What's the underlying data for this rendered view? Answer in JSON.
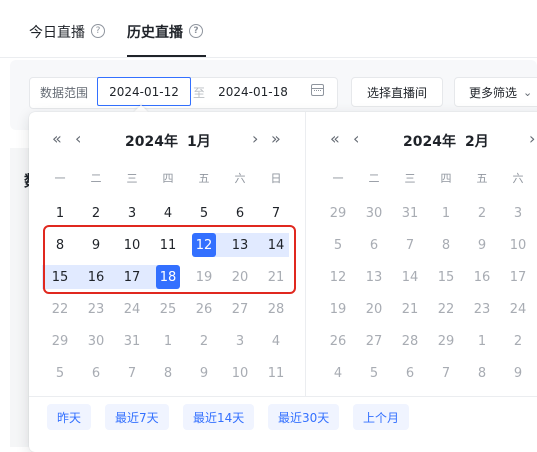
{
  "tabs": [
    {
      "label": "今日直播",
      "help": "?"
    },
    {
      "label": "历史直播",
      "help": "?"
    }
  ],
  "filter": {
    "range_label": "数据范围",
    "start_date": "2024-01-12",
    "separator": "至",
    "end_date": "2024-01-18",
    "select_room_label": "选择直播间",
    "more_filter_label": "更多筛选"
  },
  "calendar": {
    "nav": {
      "prev_year": "«",
      "prev_month": "‹",
      "next_month": "›",
      "next_year": "»"
    },
    "weekdays": [
      "一",
      "二",
      "三",
      "四",
      "五",
      "六",
      "日"
    ],
    "left": {
      "year": "2024年",
      "month": "1月",
      "weeks": [
        [
          "1",
          "2",
          "3",
          "4",
          "5",
          "6",
          "7"
        ],
        [
          "8",
          "9",
          "10",
          "11",
          "12",
          "13",
          "14"
        ],
        [
          "15",
          "16",
          "17",
          "18",
          "19",
          "20",
          "21"
        ],
        [
          "22",
          "23",
          "24",
          "25",
          "26",
          "27",
          "28"
        ],
        [
          "29",
          "30",
          "31",
          "1",
          "2",
          "3",
          "4"
        ],
        [
          "5",
          "6",
          "7",
          "8",
          "9",
          "10",
          "11"
        ]
      ]
    },
    "right": {
      "year": "2024年",
      "month": "2月",
      "weeks": [
        [
          "29",
          "30",
          "31",
          "1",
          "2",
          "3"
        ],
        [
          "5",
          "6",
          "7",
          "8",
          "9",
          "10"
        ],
        [
          "12",
          "13",
          "14",
          "15",
          "16",
          "17"
        ],
        [
          "19",
          "20",
          "21",
          "22",
          "23",
          "24"
        ],
        [
          "26",
          "27",
          "28",
          "29",
          "1",
          "2"
        ],
        [
          "4",
          "5",
          "6",
          "7",
          "8",
          "9"
        ]
      ]
    },
    "shortcuts": [
      "昨天",
      "最近7天",
      "最近14天",
      "最近30天",
      "上个月"
    ]
  },
  "background": {
    "peek_text": "数"
  },
  "colors": {
    "accent": "#3370ff",
    "range_fill": "#e1eaff",
    "annotation": "#e0281f"
  }
}
